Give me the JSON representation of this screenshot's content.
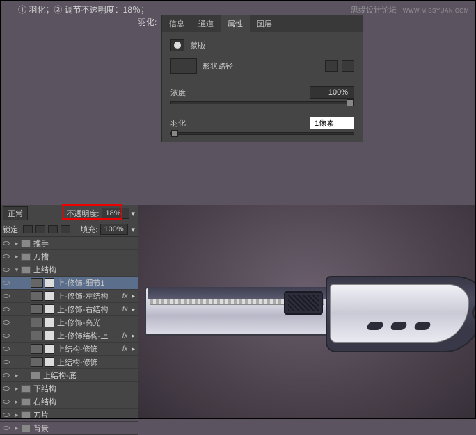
{
  "instructions": "① 羽化；② 调节不透明度：18％；",
  "feather_label": "羽化:",
  "watermark": {
    "main": "思缘设计论坛",
    "sub": "WWW.MISSYUAN.COM"
  },
  "props": {
    "tabs": [
      "信息",
      "通道",
      "属性",
      "图层"
    ],
    "active_tab": 2,
    "mask_label": "蒙版",
    "shape_path": "形状路径",
    "density_label": "浓度:",
    "density_value": "100%",
    "feather_label": "羽化:",
    "feather_value": "1像素"
  },
  "layers": {
    "blend_mode": "正常",
    "opacity_label": "不透明度:",
    "opacity_value": "18%",
    "lock_label": "锁定:",
    "fill_label": "填充:",
    "fill_value": "100%",
    "rows": [
      {
        "type": "folder",
        "indent": 0,
        "name": "推手",
        "exp": "▸"
      },
      {
        "type": "folder",
        "indent": 0,
        "name": "刀槽",
        "exp": "▸"
      },
      {
        "type": "folder",
        "indent": 0,
        "name": "上结构",
        "exp": "▾"
      },
      {
        "type": "layer",
        "indent": 1,
        "name": "上-修饰-细节1",
        "sel": true
      },
      {
        "type": "layer",
        "indent": 1,
        "name": "上-修饰-左结构",
        "fx": true
      },
      {
        "type": "layer",
        "indent": 1,
        "name": "上-修饰-右结构",
        "fx": true
      },
      {
        "type": "layer",
        "indent": 1,
        "name": "上-修饰-高光"
      },
      {
        "type": "layer",
        "indent": 1,
        "name": "上-修饰结构-上",
        "fx": true
      },
      {
        "type": "layer",
        "indent": 1,
        "name": "上结构-修饰",
        "fx": true
      },
      {
        "type": "layer",
        "indent": 1,
        "name": "上结构-修饰",
        "u": true
      },
      {
        "type": "folder",
        "indent": 1,
        "name": "上结构-底",
        "exp": "▸"
      },
      {
        "type": "folder",
        "indent": 0,
        "name": "下结构",
        "exp": "▸"
      },
      {
        "type": "folder",
        "indent": 0,
        "name": "右结构",
        "exp": "▸"
      },
      {
        "type": "folder",
        "indent": 0,
        "name": "刀片",
        "exp": "▸"
      },
      {
        "type": "folder",
        "indent": 0,
        "name": "背景",
        "exp": "▸"
      }
    ]
  }
}
